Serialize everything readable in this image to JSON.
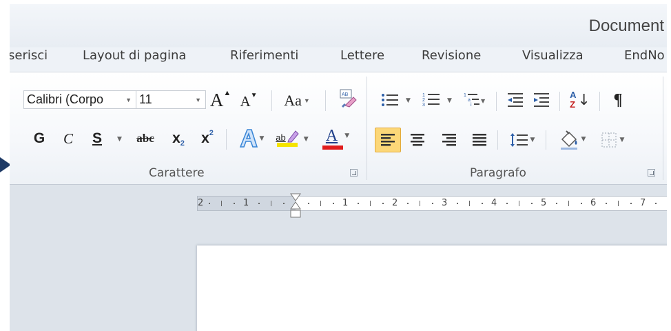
{
  "window": {
    "title": "Document"
  },
  "tabs": [
    {
      "label": "serisci"
    },
    {
      "label": "Layout di pagina"
    },
    {
      "label": "Riferimenti"
    },
    {
      "label": "Lettere"
    },
    {
      "label": "Revisione"
    },
    {
      "label": "Visualizza"
    },
    {
      "label": "EndNo"
    }
  ],
  "font_group": {
    "label": "Carattere",
    "font_name": "Calibri (Corpo",
    "font_size": "11",
    "grow_label": "A",
    "shrink_label": "A",
    "case_label": "Aa",
    "bold_label": "G",
    "italic_label": "C",
    "underline_label": "S",
    "strike_label": "abc",
    "subscript_label": "x",
    "subscript_mark": "2",
    "superscript_label": "x",
    "superscript_mark": "2",
    "font_color_label": "A",
    "highlight_label": "ab",
    "colors": {
      "highlight": "#f5e400",
      "font_color": "#e01c1c",
      "text_effects": "#3a86d6"
    }
  },
  "paragraph_group": {
    "label": "Paragrafo",
    "sort_label_a": "A",
    "sort_label_z": "Z",
    "pilcrow": "¶",
    "colors": {
      "active_align_bg": "#fcd778",
      "active_align_border": "#e2a93b"
    }
  },
  "ruler": {
    "labels": [
      "2",
      "1",
      "1",
      "2",
      "3",
      "4",
      "5",
      "6",
      "7"
    ]
  },
  "colors": {
    "accent_arrow": "#1f3b66"
  }
}
